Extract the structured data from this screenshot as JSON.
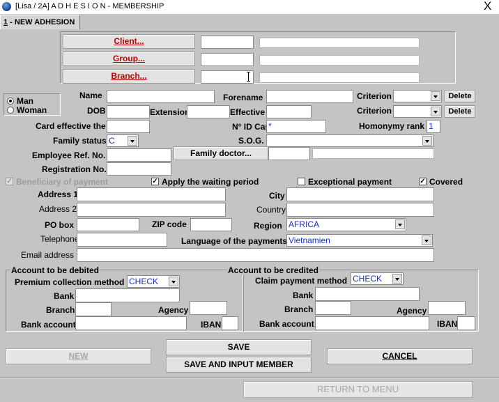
{
  "window": {
    "title": "[Lisa / 2A] A D H E S I O N - MEMBERSHIP",
    "close": "X"
  },
  "tab": {
    "number": "1",
    "label": " - NEW ADHESION"
  },
  "affiliation": {
    "client_button": "Client...",
    "group_button": "Group...",
    "branch_button": "Branch..."
  },
  "gender": {
    "man": "Man",
    "woman": "Woman"
  },
  "labels": {
    "name": "Name",
    "forename": "Forename",
    "criterion": "Criterion",
    "dob": "DOB",
    "extension": "Extension",
    "effective": "Effective",
    "card_effective": "Card effective the",
    "id_card": "N° ID Car",
    "homonymy_rank": "Homonymy rank",
    "family_status": "Family status",
    "sog": "S.O.G.",
    "employee_ref": "Employee Ref. No.",
    "registration": "Registration No.",
    "address1": "Address 1",
    "address2": "Address 2",
    "city": "City",
    "country": "Country",
    "po_box": "PO box",
    "zip": "ZIP code",
    "region": "Region",
    "telephone": "Telephone",
    "language": "Language of the payments",
    "email": "Email address"
  },
  "buttons": {
    "delete": "Delete",
    "family_doctor": "Family doctor...",
    "new": "NEW",
    "save": "SAVE",
    "save_input": "SAVE AND INPUT MEMBER",
    "cancel": "CANCEL",
    "return_menu": "RETURN TO MENU"
  },
  "values": {
    "id_card": "*",
    "homonymy_rank": "1",
    "family_status": "C",
    "region": "AFRICA",
    "language": "Vietnamien",
    "debit_method": "CHECK",
    "credit_method": "CHECK"
  },
  "checkboxes": {
    "beneficiary": "Beneficiary of payment",
    "waiting_period": "Apply the waiting period",
    "exceptional": "Exceptional payment",
    "covered": "Covered"
  },
  "debited": {
    "title": "Account to be debited",
    "method_label": "Premium collection method",
    "bank": "Bank",
    "branch": "Branch",
    "agency": "Agency",
    "bank_account": "Bank account",
    "iban": "IBAN"
  },
  "credited": {
    "title": "Account to be credited",
    "method_label": "Claim payment method",
    "bank": "Bank",
    "branch": "Branch",
    "agency": "Agency",
    "bank_account": "Bank account",
    "iban": "IBAN"
  }
}
